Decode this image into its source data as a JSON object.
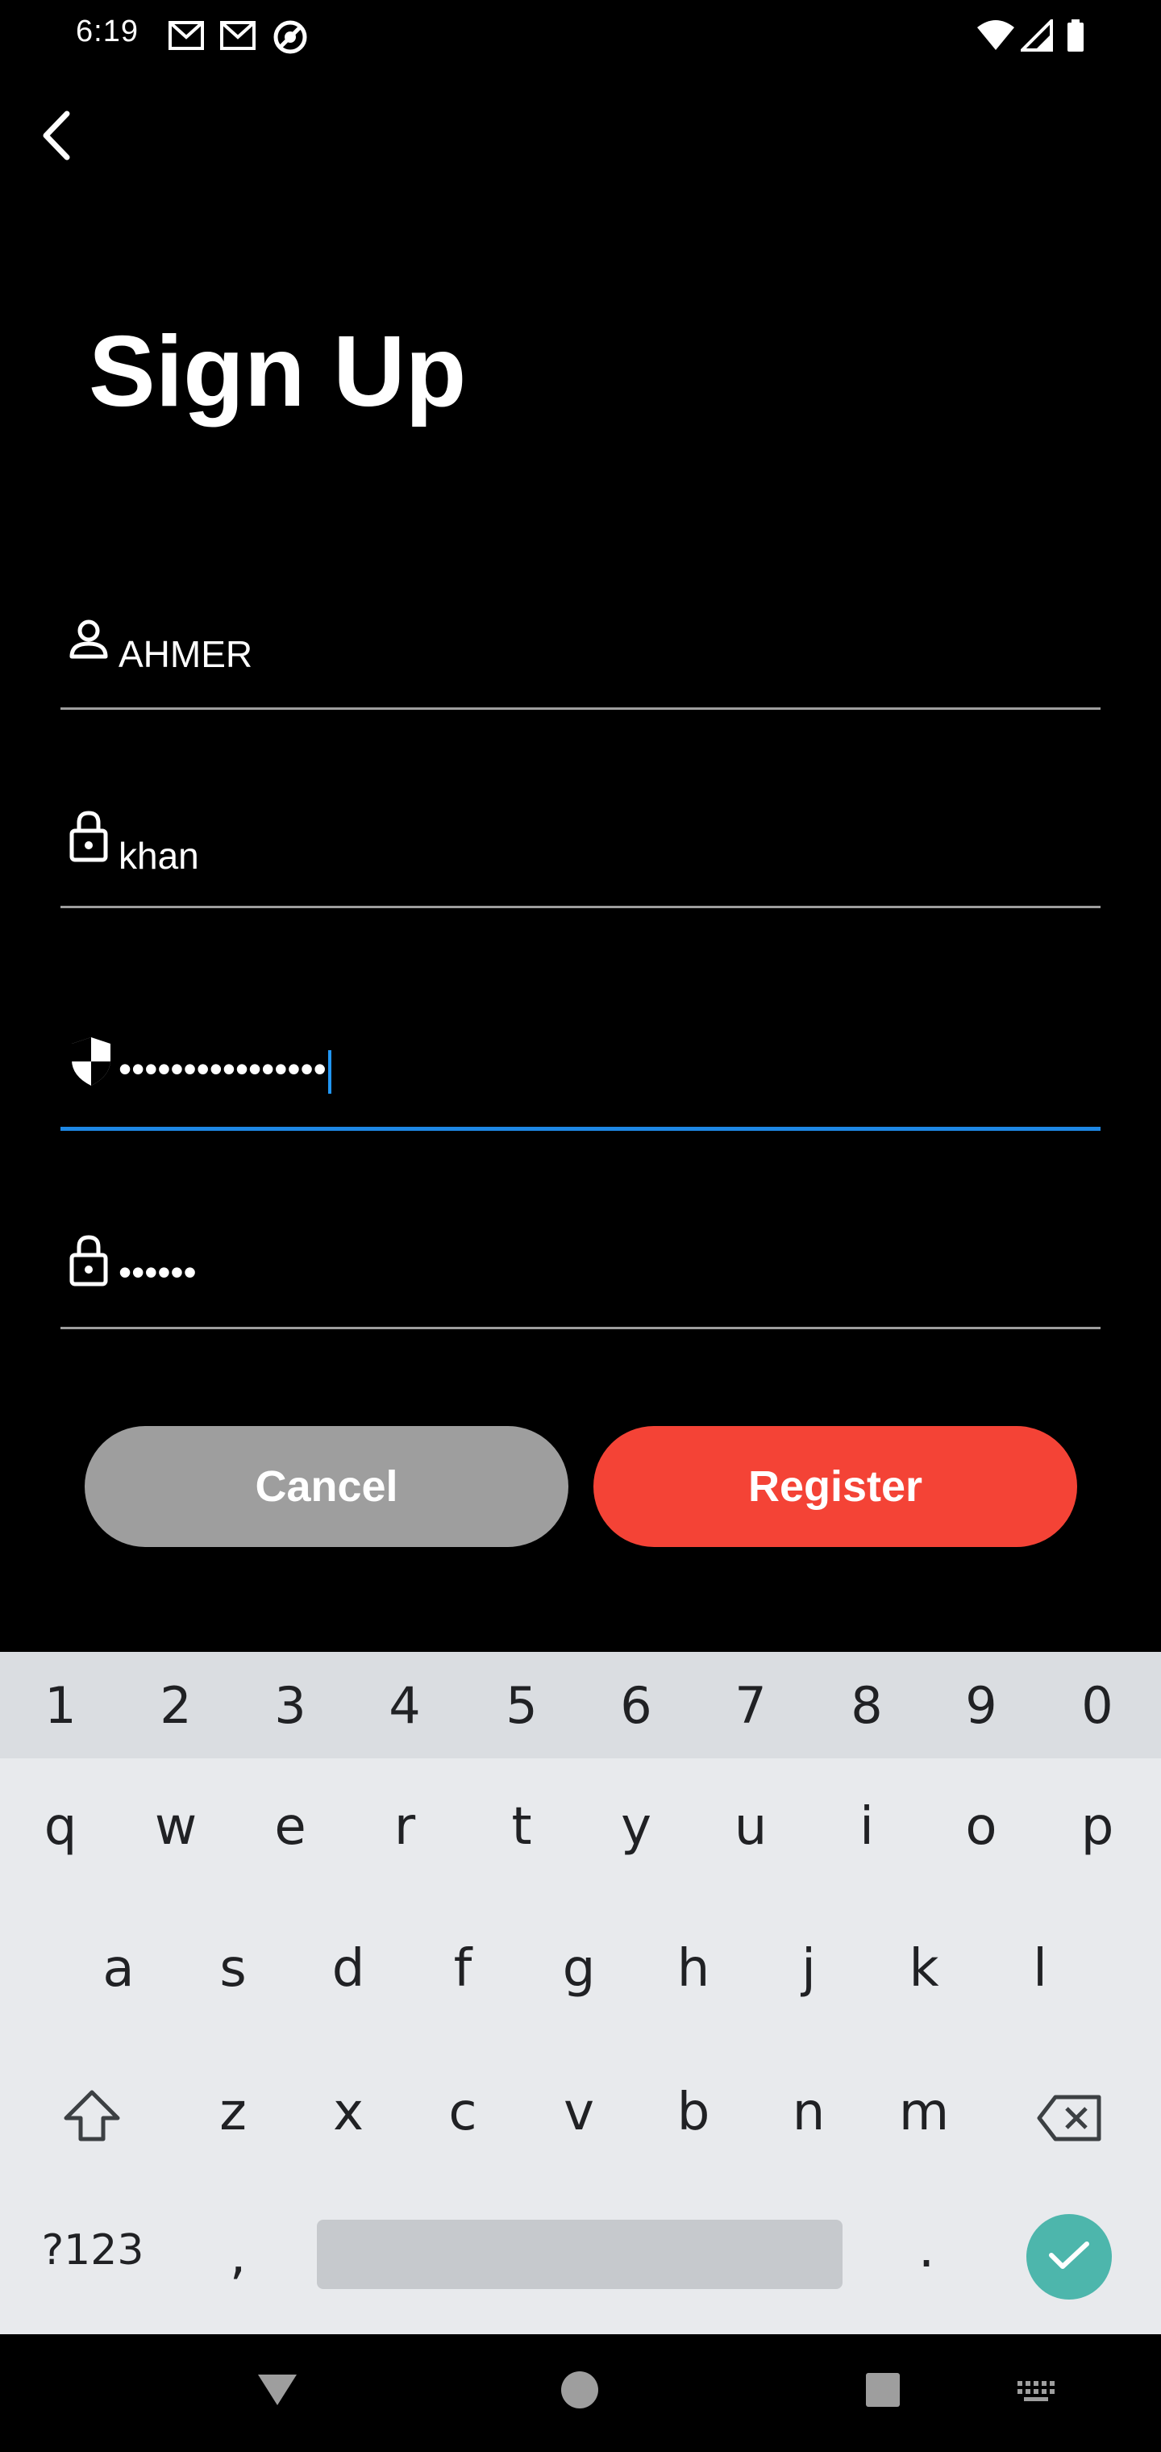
{
  "status_bar": {
    "time": "6:19",
    "left_icons": [
      "gmail-icon",
      "gmail-icon",
      "sync-icon"
    ],
    "right_icons": [
      "wifi-icon",
      "signal-icon",
      "battery-icon"
    ]
  },
  "screen": {
    "title": "Sign Up"
  },
  "form": {
    "username": {
      "icon": "person-icon",
      "value": "AHMER"
    },
    "lastname": {
      "icon": "lock-icon",
      "value": "khan"
    },
    "password": {
      "icon": "shield-icon",
      "value": "••••••••••••••••"
    },
    "confirm_password": {
      "icon": "lock-icon",
      "value": "••••••"
    }
  },
  "buttons": {
    "cancel_label": "Cancel",
    "register_label": "Register"
  },
  "keyboard": {
    "number_row": [
      "1",
      "2",
      "3",
      "4",
      "5",
      "6",
      "7",
      "8",
      "9",
      "0"
    ],
    "row1": [
      "q",
      "w",
      "e",
      "r",
      "t",
      "y",
      "u",
      "i",
      "o",
      "p"
    ],
    "row2": [
      "a",
      "s",
      "d",
      "f",
      "g",
      "h",
      "j",
      "k",
      "l"
    ],
    "row3": [
      "z",
      "x",
      "c",
      "v",
      "b",
      "n",
      "m"
    ],
    "symbols_label": "?123",
    "comma": ",",
    "period": "."
  },
  "colors": {
    "register": "#f44336",
    "cancel": "#9e9e9e",
    "focus_line": "#1e88e5",
    "enter_key": "#4db6ac"
  }
}
